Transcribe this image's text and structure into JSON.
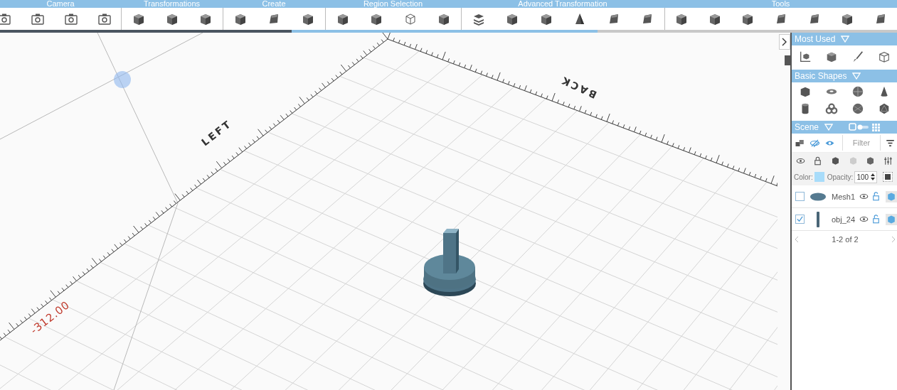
{
  "toolbar": {
    "groups": [
      {
        "title": "Camera"
      },
      {
        "title": "Transformations"
      },
      {
        "title": "Create"
      },
      {
        "title": "Region Selection"
      },
      {
        "title": "Advanced Transformation"
      },
      {
        "title": "Tools"
      }
    ]
  },
  "viewport": {
    "axis_labels": [
      {
        "text": "LEFT",
        "kind": "left"
      },
      {
        "text": "BACK",
        "kind": "back"
      },
      {
        "text": "-312.00",
        "kind": "coord"
      }
    ]
  },
  "panel": {
    "most_used": {
      "title": "Most Used",
      "expanded": true
    },
    "basic_shapes": {
      "title": "Basic Shapes",
      "expanded": true
    },
    "scene": {
      "title": "Scene",
      "expanded": true,
      "filter_placeholder": "Filter",
      "color_label": "Color:",
      "opacity_label": "Opacity:",
      "opacity": "100",
      "items": [
        {
          "name": "Mesh1",
          "checked": false,
          "kind": "disc"
        },
        {
          "name": "obj_24",
          "checked": true,
          "kind": "bar"
        }
      ],
      "pagination": "1-2 of 2"
    }
  }
}
